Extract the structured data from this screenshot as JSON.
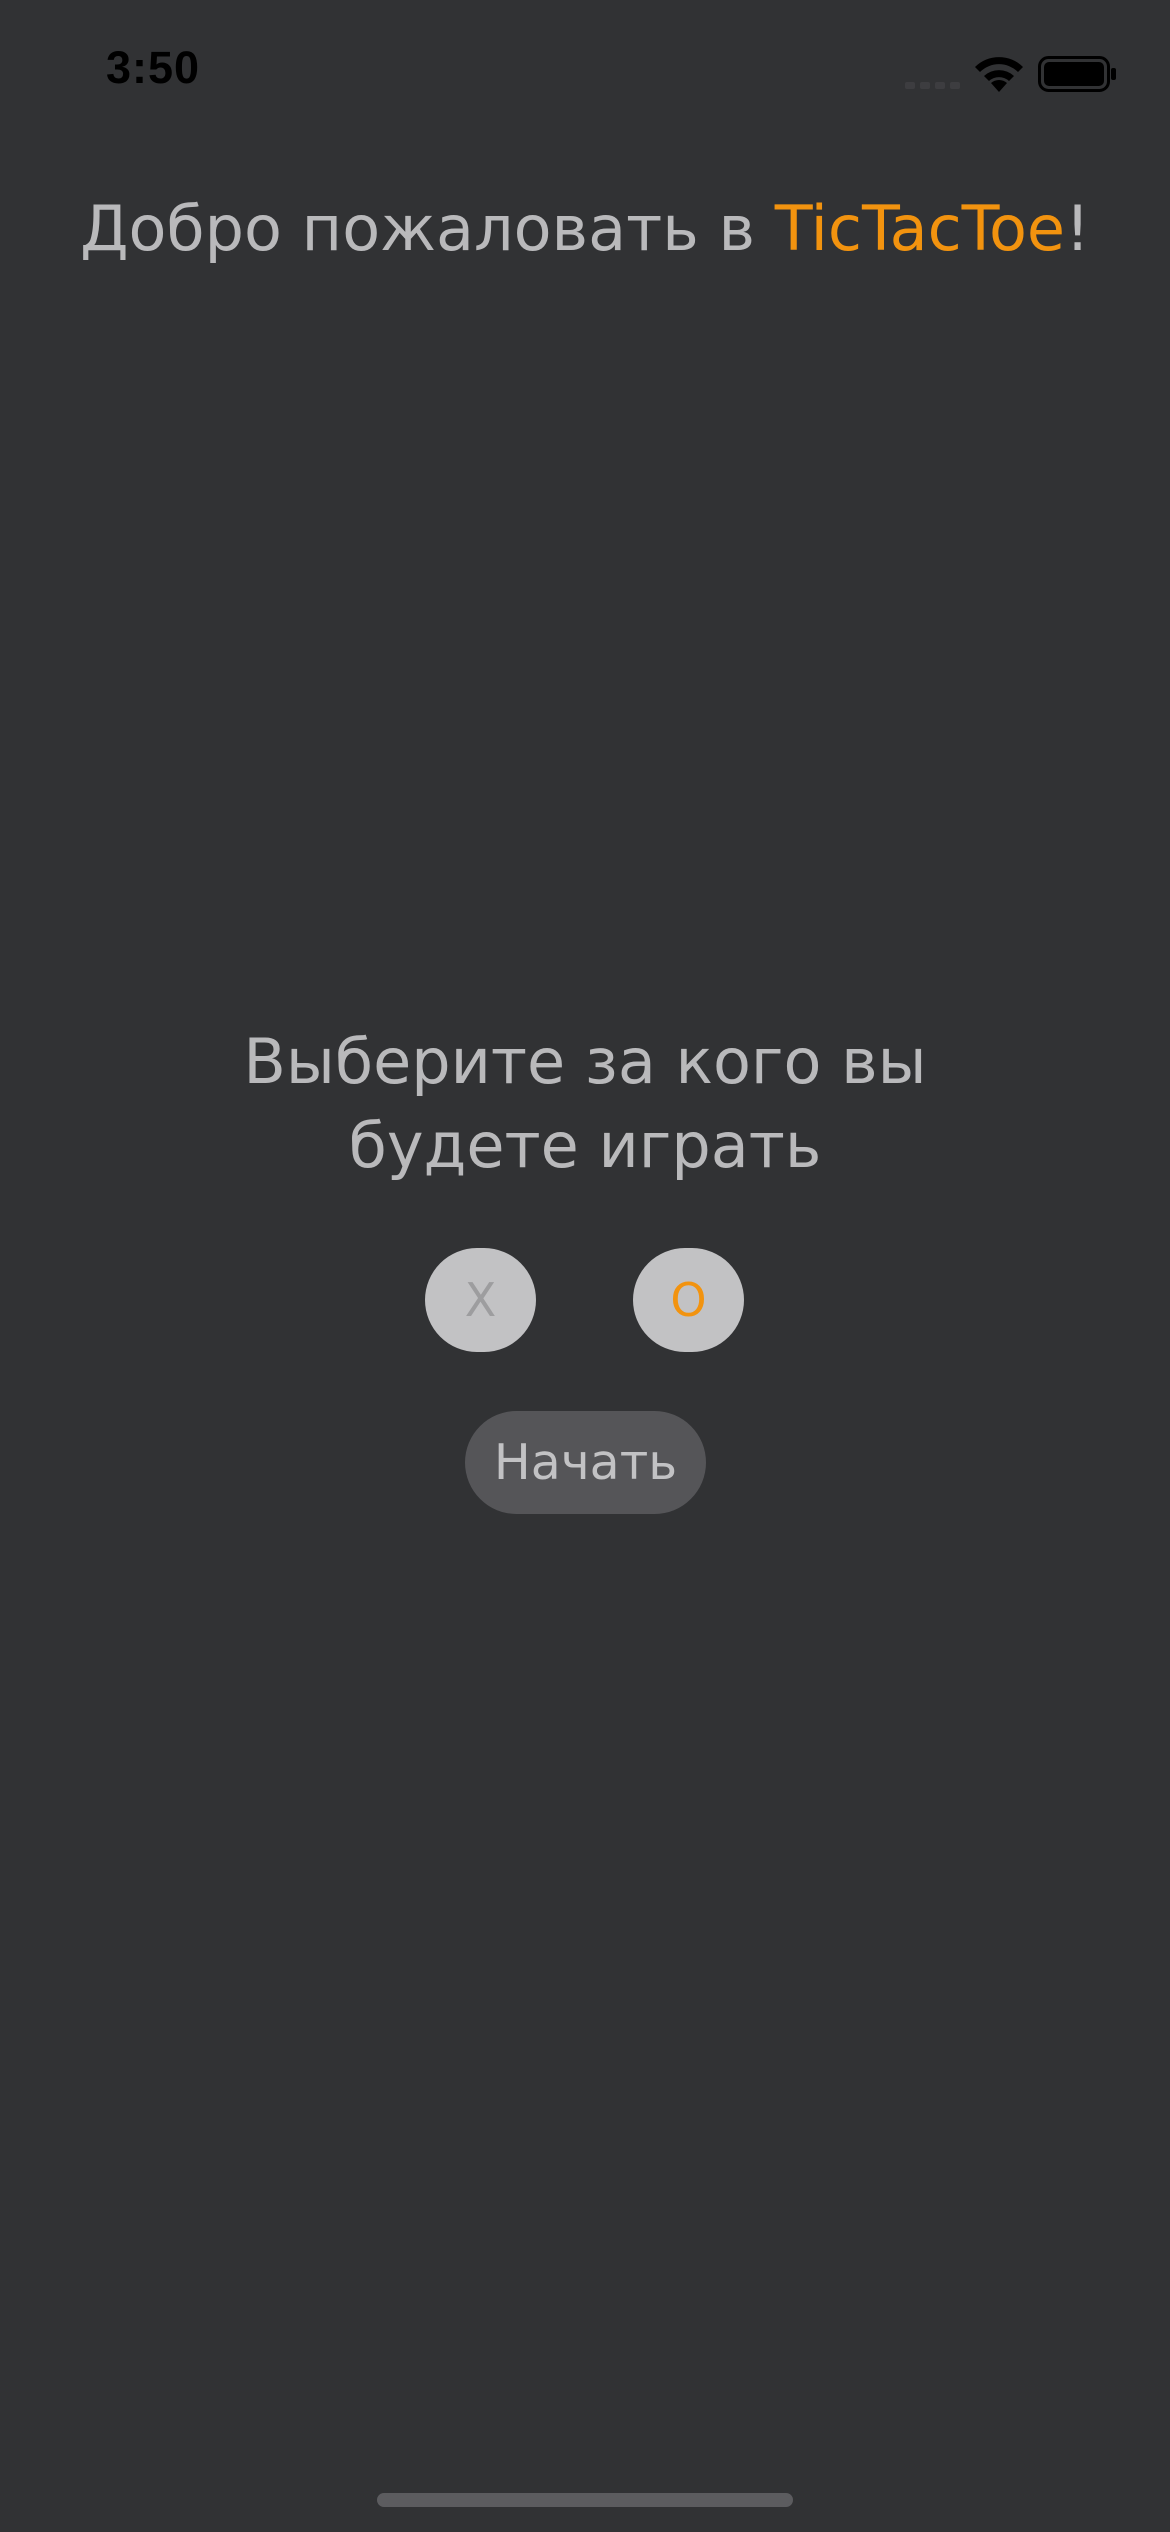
{
  "status_bar": {
    "time": "3:50",
    "icons": [
      "cellular-signal-icon",
      "wifi-icon",
      "battery-icon"
    ]
  },
  "header": {
    "title_prefix": "Добро пожаловать в ",
    "title_brand": "TicTacToe",
    "title_suffix": "!"
  },
  "main": {
    "prompt": "Выберите за кого вы будете играть",
    "choices": [
      {
        "label": "X",
        "color": "#9d9d9f",
        "selected": false
      },
      {
        "label": "O",
        "color": "#f2930f",
        "selected": true
      }
    ],
    "start_label": "Начать"
  },
  "colors": {
    "background": "#313234",
    "accent": "#f2930f",
    "text": "#b9b9bb",
    "choice_bg": "#c2c2c4",
    "start_bg": "#555558"
  }
}
